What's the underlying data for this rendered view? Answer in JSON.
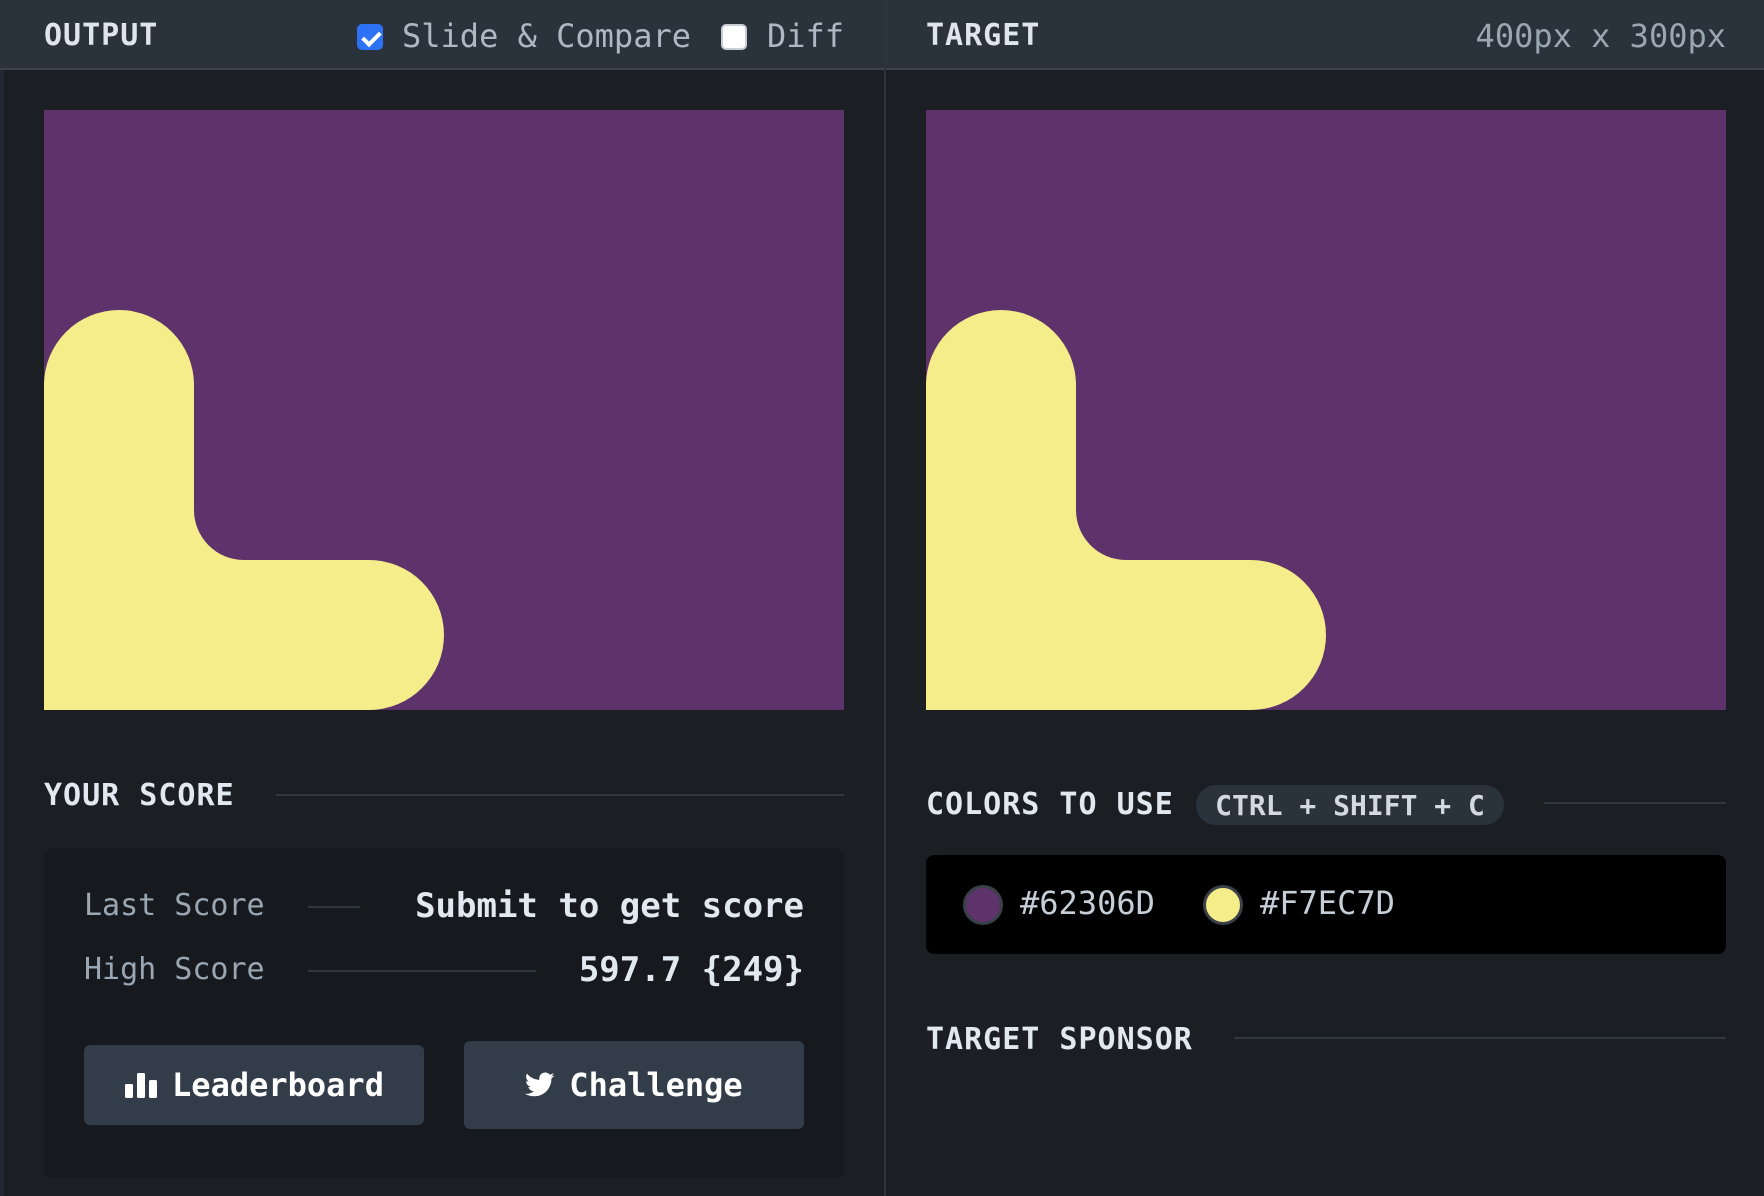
{
  "header": {
    "output_label": "OUTPUT",
    "slide_compare_label": "Slide & Compare",
    "slide_compare_checked": true,
    "diff_label": "Diff",
    "diff_checked": false,
    "target_label": "TARGET",
    "dimensions": "400px x 300px"
  },
  "score": {
    "title": "YOUR SCORE",
    "last_label": "Last Score",
    "last_value": "Submit to get score",
    "high_label": "High Score",
    "high_value": "597.7 {249}",
    "leaderboard_label": "Leaderboard",
    "challenge_label": "Challenge"
  },
  "colors": {
    "title": "COLORS TO USE",
    "shortcut": "CTRL + SHIFT + C",
    "items": [
      {
        "hex": "#62306D",
        "color": "#5e336b"
      },
      {
        "hex": "#F7EC7D",
        "color": "#f5ec8a"
      }
    ]
  },
  "sponsor": {
    "title": "TARGET SPONSOR"
  },
  "theme": {
    "background": "#1b1f24",
    "topbar": "#2a323c",
    "accent": "#2d72f5",
    "canvas_bg": "#5e336b",
    "shape_fill": "#f5ec8a"
  },
  "icons": {
    "leaderboard": "bar-chart-icon",
    "challenge": "twitter-bird-icon",
    "slide_compare": "checkbox-checked-icon",
    "diff": "checkbox-empty-icon"
  }
}
